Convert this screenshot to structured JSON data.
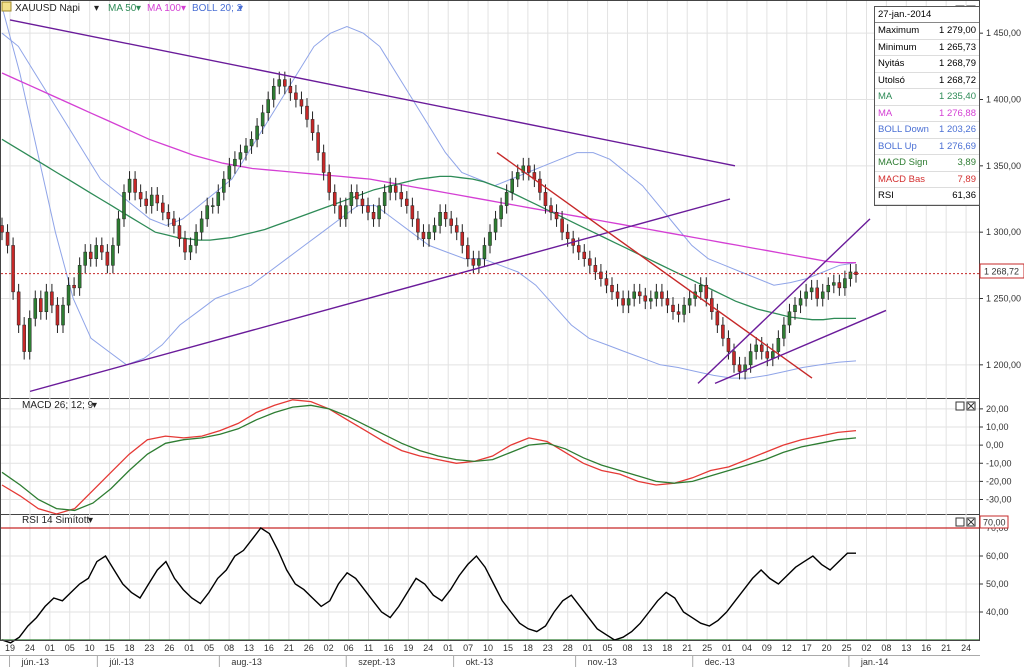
{
  "toolbar": {
    "symbol": "XAUUSD Napi",
    "ma1": "MA 50",
    "ma2": "MA 100",
    "boll": "BOLL 20; 2"
  },
  "info_panel": {
    "date": "27-jan.-2014",
    "rows": [
      {
        "label": "Maximum",
        "value": "1 279,00",
        "color": "#000000"
      },
      {
        "label": "Minimum",
        "value": "1 265,73",
        "color": "#000000"
      },
      {
        "label": "Nyitás",
        "value": "1 268,79",
        "color": "#000000"
      },
      {
        "label": "Utolsó",
        "value": "1 268,72",
        "color": "#000000"
      },
      {
        "label": "MA",
        "value": "1 235,40",
        "color": "#2e8b57"
      },
      {
        "label": "MA",
        "value": "1 276,88",
        "color": "#d43fd4"
      },
      {
        "label": "BOLL Down",
        "value": "1 203,26",
        "color": "#4a6fd4"
      },
      {
        "label": "BOLL Up",
        "value": "1 276,69",
        "color": "#4a6fd4"
      },
      {
        "label": "MACD Sign",
        "value": "3,89",
        "color": "#2e7d32"
      },
      {
        "label": "MACD Bas",
        "value": "7,89",
        "color": "#d32f2f"
      },
      {
        "label": "RSI",
        "value": "61,36",
        "color": "#000000"
      }
    ]
  },
  "panels": {
    "macd_label": "MACD 26; 12; 9",
    "rsi_label": "RSI 14 Simított",
    "rsi_level": "70,00",
    "last_price_label": "1 268,72"
  },
  "chart_data": [
    {
      "type": "candlestick",
      "title": "XAUUSD Napi",
      "ylim": [
        1175,
        1475
      ],
      "y_ticks": [
        "1 450,00",
        "1 400,00",
        "1 350,00",
        "1 300,00",
        "1 250,00",
        "1 200,00"
      ],
      "y_tick_values": [
        1450,
        1400,
        1350,
        1300,
        1250,
        1200
      ],
      "last_price": 1268.72,
      "close": [
        1300,
        1290,
        1255,
        1230,
        1210,
        1235,
        1250,
        1240,
        1255,
        1245,
        1230,
        1245,
        1260,
        1258,
        1275,
        1285,
        1280,
        1290,
        1285,
        1275,
        1290,
        1310,
        1330,
        1340,
        1330,
        1325,
        1320,
        1328,
        1322,
        1315,
        1310,
        1305,
        1295,
        1285,
        1290,
        1300,
        1310,
        1320,
        1320,
        1330,
        1340,
        1350,
        1355,
        1360,
        1365,
        1370,
        1380,
        1390,
        1400,
        1410,
        1415,
        1410,
        1405,
        1400,
        1395,
        1385,
        1375,
        1360,
        1345,
        1330,
        1320,
        1310,
        1320,
        1330,
        1325,
        1320,
        1315,
        1310,
        1320,
        1330,
        1335,
        1330,
        1325,
        1320,
        1310,
        1300,
        1295,
        1300,
        1305,
        1315,
        1310,
        1305,
        1300,
        1290,
        1280,
        1275,
        1280,
        1290,
        1300,
        1310,
        1320,
        1330,
        1340,
        1345,
        1350,
        1345,
        1340,
        1330,
        1320,
        1315,
        1310,
        1300,
        1295,
        1290,
        1285,
        1280,
        1275,
        1270,
        1265,
        1260,
        1255,
        1250,
        1245,
        1250,
        1255,
        1252,
        1248,
        1250,
        1255,
        1250,
        1245,
        1240,
        1238,
        1245,
        1250,
        1255,
        1260,
        1250,
        1240,
        1230,
        1220,
        1210,
        1200,
        1195,
        1200,
        1210,
        1215,
        1210,
        1205,
        1210,
        1220,
        1230,
        1240,
        1245,
        1250,
        1255,
        1258,
        1250,
        1255,
        1260,
        1262,
        1258,
        1265,
        1270,
        1268
      ],
      "ma50": [
        1370,
        1365,
        1360,
        1355,
        1350,
        1345,
        1340,
        1335,
        1330,
        1325,
        1320,
        1315,
        1310,
        1305,
        1300,
        1298,
        1296,
        1295,
        1294,
        1294,
        1295,
        1296,
        1298,
        1300,
        1302,
        1305,
        1308,
        1311,
        1314,
        1317,
        1320,
        1323,
        1326,
        1329,
        1332,
        1334,
        1336,
        1338,
        1340,
        1341,
        1342,
        1342,
        1341,
        1340,
        1338,
        1335,
        1332,
        1328,
        1324,
        1320,
        1316,
        1312,
        1308,
        1304,
        1300,
        1296,
        1292,
        1288,
        1284,
        1280,
        1276,
        1272,
        1268,
        1264,
        1260,
        1256,
        1252,
        1248,
        1245,
        1242,
        1240,
        1238,
        1236,
        1235,
        1234,
        1234,
        1235,
        1235,
        1235
      ],
      "ma100": [
        1420,
        1415,
        1410,
        1405,
        1400,
        1395,
        1390,
        1385,
        1380,
        1375,
        1370,
        1366,
        1362,
        1358,
        1355,
        1352,
        1350,
        1348,
        1347,
        1346,
        1345,
        1344,
        1343,
        1342,
        1341,
        1340,
        1338,
        1336,
        1334,
        1332,
        1330,
        1328,
        1326,
        1324,
        1322,
        1320,
        1318,
        1316,
        1314,
        1312,
        1310,
        1308,
        1306,
        1304,
        1302,
        1300,
        1298,
        1296,
        1294,
        1292,
        1290,
        1288,
        1286,
        1284,
        1282,
        1280,
        1278,
        1277,
        1277
      ],
      "boll_up": [
        1450,
        1440,
        1420,
        1400,
        1380,
        1360,
        1340,
        1330,
        1320,
        1310,
        1305,
        1310,
        1320,
        1330,
        1340,
        1360,
        1380,
        1400,
        1420,
        1440,
        1450,
        1455,
        1450,
        1440,
        1420,
        1400,
        1380,
        1360,
        1345,
        1340,
        1335,
        1340,
        1345,
        1350,
        1355,
        1360,
        1360,
        1355,
        1345,
        1335,
        1320,
        1305,
        1290,
        1280,
        1275,
        1270,
        1265,
        1260,
        1262,
        1265,
        1270,
        1275,
        1277
      ],
      "boll_down": [
        1470,
        1420,
        1360,
        1300,
        1250,
        1220,
        1210,
        1200,
        1205,
        1215,
        1230,
        1240,
        1250,
        1255,
        1260,
        1270,
        1280,
        1290,
        1300,
        1310,
        1320,
        1320,
        1310,
        1300,
        1290,
        1285,
        1280,
        1280,
        1275,
        1270,
        1260,
        1245,
        1230,
        1220,
        1215,
        1210,
        1205,
        1200,
        1198,
        1195,
        1192,
        1190,
        1190,
        1192,
        1195,
        1198,
        1200,
        1202,
        1203
      ],
      "trendlines": [
        {
          "from": [
            0,
            1460
          ],
          "to": [
            1,
            1350
          ],
          "color": "#6a1b9a"
        },
        {
          "from": [
            0,
            1180
          ],
          "to": [
            1,
            1325
          ],
          "color": "#6a1b9a"
        },
        {
          "from": [
            0,
            1360
          ],
          "to": [
            1,
            1190
          ],
          "color": "#c62828"
        }
      ]
    },
    {
      "type": "line",
      "title": "MACD 26; 12; 9",
      "ylim": [
        -38,
        26
      ],
      "y_ticks": [
        "20,00",
        "10,00",
        "0,00",
        "-10,00",
        "-20,00",
        "-30,00"
      ],
      "y_tick_values": [
        20,
        10,
        0,
        -10,
        -20,
        -30
      ],
      "series": [
        {
          "name": "MACD Bas",
          "color": "#e53935",
          "values": [
            -22,
            -28,
            -35,
            -38,
            -35,
            -25,
            -15,
            -5,
            3,
            5,
            4,
            5,
            8,
            12,
            18,
            22,
            25,
            24,
            20,
            14,
            8,
            2,
            -3,
            -6,
            -8,
            -10,
            -9,
            -6,
            0,
            4,
            2,
            -4,
            -10,
            -14,
            -16,
            -20,
            -22,
            -21,
            -18,
            -14,
            -12,
            -8,
            -4,
            0,
            3,
            5,
            7,
            8
          ]
        },
        {
          "name": "MACD Sign",
          "color": "#2e7d32",
          "values": [
            -15,
            -22,
            -30,
            -35,
            -36,
            -32,
            -24,
            -14,
            -5,
            1,
            3,
            4,
            6,
            9,
            14,
            18,
            21,
            22,
            20,
            16,
            11,
            6,
            1,
            -3,
            -6,
            -8,
            -9,
            -8,
            -4,
            0,
            1,
            -2,
            -7,
            -11,
            -14,
            -17,
            -20,
            -21,
            -20,
            -17,
            -14,
            -11,
            -8,
            -4,
            -1,
            1,
            3,
            4
          ]
        }
      ]
    },
    {
      "type": "line",
      "title": "RSI 14 Simított",
      "ylim": [
        30,
        75
      ],
      "y_ticks": [
        "70,00",
        "60,00",
        "50,00",
        "40,00"
      ],
      "y_tick_values": [
        70,
        60,
        50,
        40
      ],
      "series": [
        {
          "name": "RSI",
          "color": "#000000",
          "values": [
            30,
            29,
            31,
            35,
            38,
            42,
            45,
            44,
            47,
            50,
            52,
            58,
            60,
            55,
            50,
            47,
            45,
            50,
            55,
            58,
            52,
            48,
            45,
            43,
            47,
            52,
            55,
            60,
            62,
            66,
            70,
            68,
            62,
            55,
            50,
            48,
            45,
            42,
            44,
            50,
            54,
            52,
            48,
            44,
            40,
            38,
            42,
            47,
            52,
            50,
            46,
            44,
            48,
            53,
            57,
            60,
            56,
            50,
            44,
            40,
            36,
            34,
            33,
            35,
            40,
            44,
            46,
            42,
            38,
            34,
            32,
            30,
            31,
            33,
            36,
            40,
            44,
            47,
            45,
            40,
            38,
            36,
            35,
            37,
            40,
            44,
            48,
            52,
            55,
            52,
            50,
            53,
            56,
            58,
            60,
            57,
            55,
            58,
            61,
            61
          ]
        }
      ]
    }
  ],
  "x_axis": {
    "day_ticks": [
      "19",
      "24",
      "01",
      "05",
      "10",
      "15",
      "18",
      "23",
      "26",
      "01",
      "05",
      "08",
      "13",
      "16",
      "21",
      "26",
      "02",
      "06",
      "11",
      "16",
      "19",
      "24",
      "01",
      "07",
      "10",
      "15",
      "18",
      "23",
      "28",
      "01",
      "05",
      "08",
      "13",
      "18",
      "21",
      "25",
      "01",
      "04",
      "09",
      "12",
      "17",
      "20",
      "25",
      "02",
      "08",
      "13",
      "16",
      "21",
      "24"
    ],
    "months": [
      {
        "label": "jún.-13",
        "at": 0.02
      },
      {
        "label": "júl.-13",
        "at": 0.11
      },
      {
        "label": "aug.-13",
        "at": 0.235
      },
      {
        "label": "szept.-13",
        "at": 0.365
      },
      {
        "label": "okt.-13",
        "at": 0.475
      },
      {
        "label": "nov.-13",
        "at": 0.6
      },
      {
        "label": "dec.-13",
        "at": 0.72
      },
      {
        "label": "jan.-14",
        "at": 0.88
      }
    ]
  }
}
